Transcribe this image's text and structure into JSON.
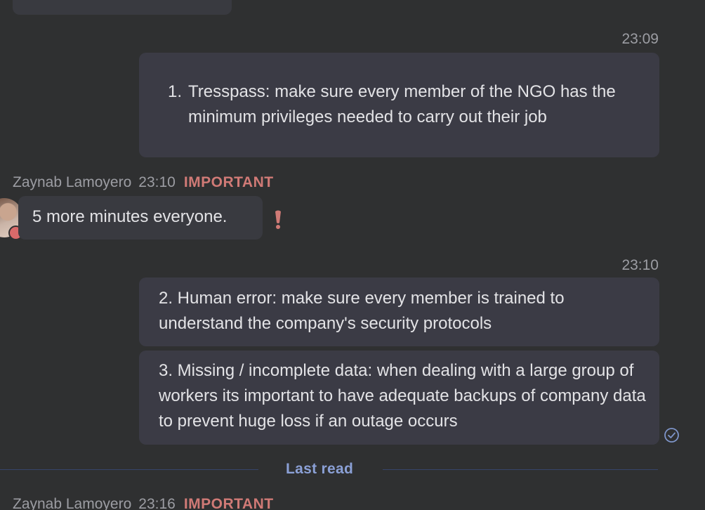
{
  "messages": {
    "m1": {
      "time": "23:09",
      "number": "1.",
      "text": "Tresspass: make sure every member of the NGO has the minimum privileges needed to carry out their job"
    },
    "m2": {
      "sender": "Zaynab Lamoyero",
      "time": "23:10",
      "tag": "IMPORTANT",
      "text": "5 more minutes everyone."
    },
    "m3": {
      "time": "23:10",
      "text": "2. Human error: make sure every member is trained to understand the company's security protocols"
    },
    "m4": {
      "text": "3. Missing / incomplete data: when dealing with a large group of workers its important to have adequate backups of company data to prevent huge loss if an outage occurs"
    },
    "m5": {
      "sender": "Zaynab Lamoyero",
      "time": "23:16",
      "tag": "IMPORTANT"
    }
  },
  "divider": {
    "label": "Last read"
  },
  "colors": {
    "background": "#2f3031",
    "bubble": "#3b3b45",
    "important": "#d07a76",
    "last_read": "#8ba0d6",
    "status_dot": "#d86a6a"
  },
  "icons": {
    "important_mark": "exclamation-icon",
    "read_receipt": "check-circle-icon"
  }
}
